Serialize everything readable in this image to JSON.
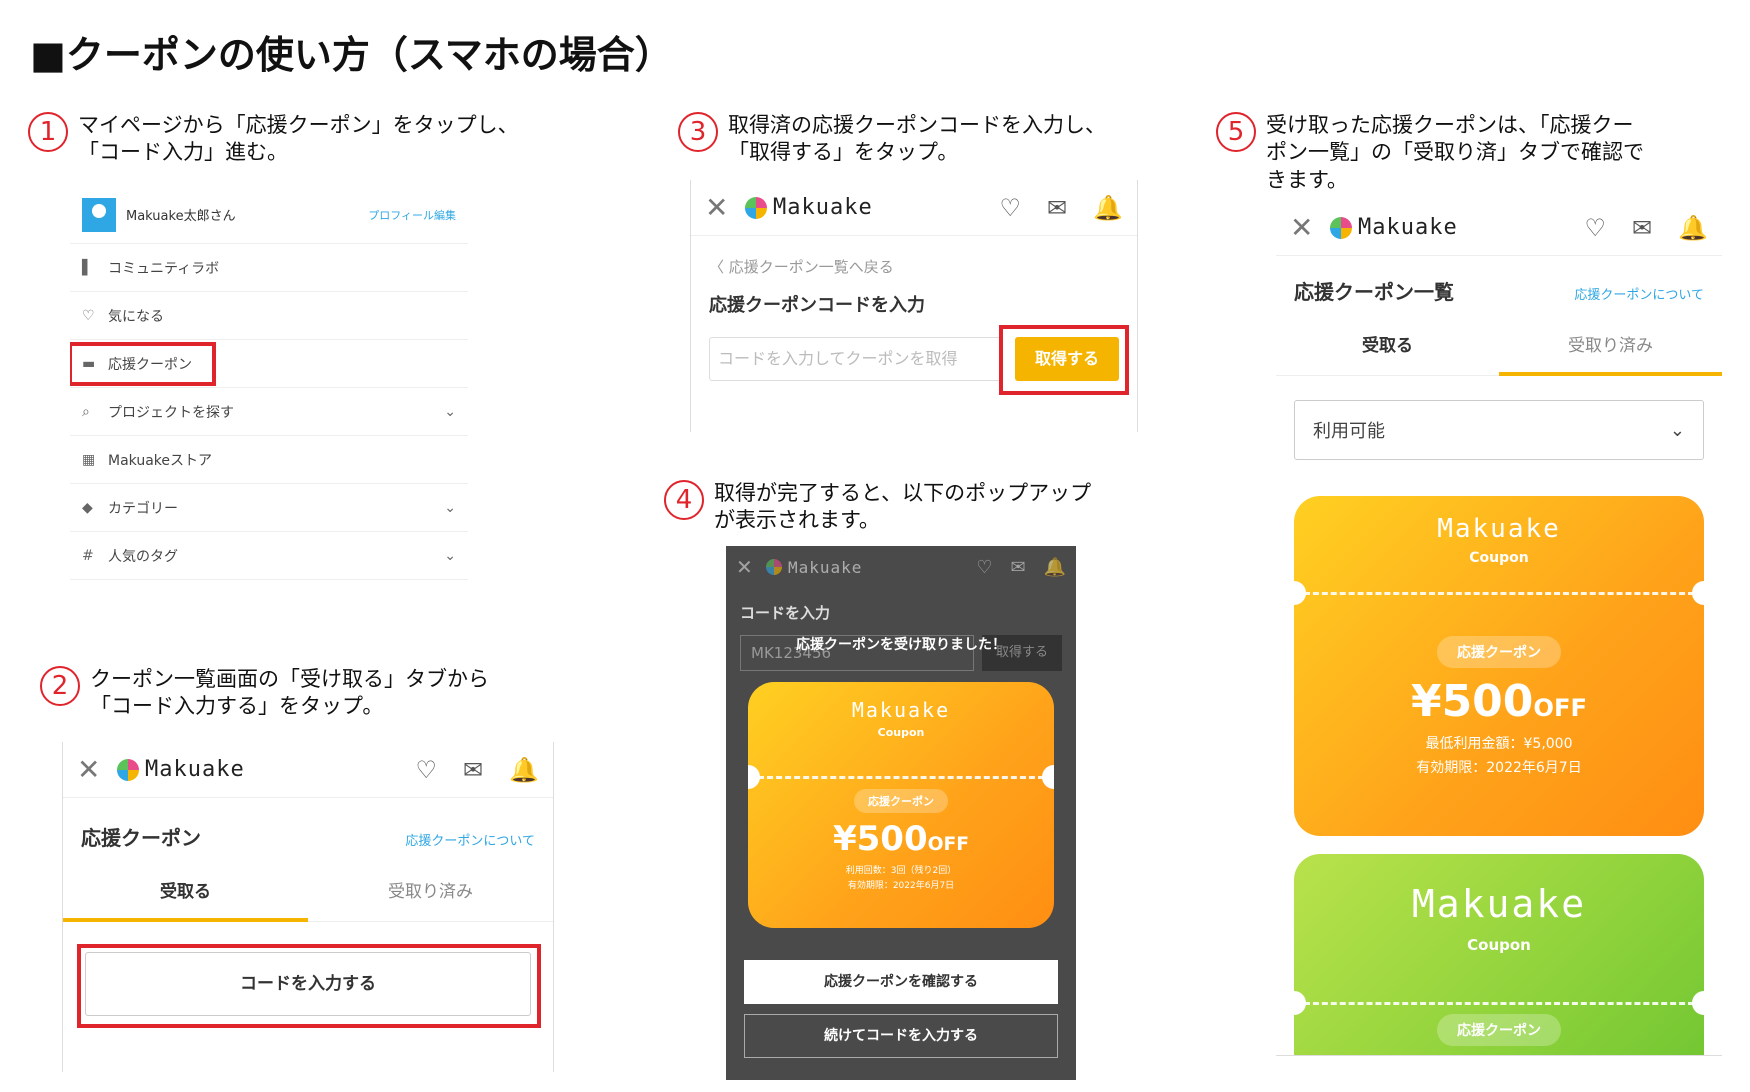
{
  "page_title": "■クーポンの使い方（スマホの場合）",
  "steps": [
    {
      "num": "1",
      "text": "マイページから「応援クーポン」をタップし、\n「コード入力」進む。"
    },
    {
      "num": "2",
      "text": "クーポン一覧画面の「受け取る」タブから\n「コード入力する」をタップ。"
    },
    {
      "num": "3",
      "text": "取得済の応援クーポンコードを入力し、\n「取得する」をタップ。"
    },
    {
      "num": "4",
      "text": "取得が完了すると、以下のポップアップ\nが表示されます。"
    },
    {
      "num": "5",
      "text": "受け取った応援クーポンは、「応援クー\nポン一覧」の「受取り済」タブで確認で\nきます。"
    }
  ],
  "header": {
    "close": "✕",
    "logo": "Makuake",
    "heart": "♡",
    "mail": "✉",
    "bell": "🔔"
  },
  "panel1": {
    "user_name": "Makuake太郎さん",
    "profile_edit": "プロフィール編集",
    "items": [
      {
        "icon": "▌",
        "label": "コミュニティラボ",
        "chev": ""
      },
      {
        "icon": "♡",
        "label": "気になる",
        "chev": ""
      },
      {
        "icon": "▬",
        "label": "応援クーポン",
        "chev": ""
      },
      {
        "icon": "⌕",
        "label": "プロジェクトを探す",
        "chev": "⌄"
      },
      {
        "icon": "▦",
        "label": "Makuakeストア",
        "chev": ""
      },
      {
        "icon": "◆",
        "label": "カテゴリー",
        "chev": "⌄"
      },
      {
        "icon": "#",
        "label": "人気のタグ",
        "chev": "⌄"
      }
    ]
  },
  "panel2": {
    "title": "応援クーポン",
    "about_link": "応援クーポンについて",
    "tab_receive": "受取る",
    "tab_received": "受取り済み",
    "code_button": "コードを入力する"
  },
  "panel3": {
    "back_link": "〈 応援クーポン一覧へ戻る",
    "title": "応援クーポンコードを入力",
    "input_placeholder": "コードを入力してクーポンを取得",
    "get_button": "取得する"
  },
  "panel4": {
    "bg_title": "コードを入力",
    "bg_input": "MK123456",
    "bg_button": "取得する",
    "toast": "応援クーポンを受け取りました！",
    "coupon_logo": "Makuake",
    "coupon_sub": "Coupon",
    "coupon_pill": "応援クーポン",
    "coupon_amount": "¥500",
    "coupon_off": "OFF",
    "coupon_line1": "利用回数：3回（残り2回）",
    "coupon_line2": "有効期限：2022年6月7日",
    "confirm_button": "応援クーポンを確認する",
    "continue_button": "続けてコードを入力する"
  },
  "panel5": {
    "title": "応援クーポン一覧",
    "about_link": "応援クーポンについて",
    "tab_receive": "受取る",
    "tab_received": "受取り済み",
    "select_value": "利用可能",
    "coupon_logo": "Makuake",
    "coupon_sub": "Coupon",
    "coupon_pill": "応援クーポン",
    "coupon_amount": "¥500",
    "coupon_off": "OFF",
    "coupon_line1": "最低利用金額：¥5,000",
    "coupon_line2": "有効期限：2022年6月7日",
    "coupon2_logo": "Makuake",
    "coupon2_sub": "Coupon",
    "coupon2_pill": "応援クーポン"
  },
  "colors": {
    "accent_red": "#e0242b",
    "brand_yellow": "#f5b400",
    "link_blue": "#2fa7e4"
  }
}
